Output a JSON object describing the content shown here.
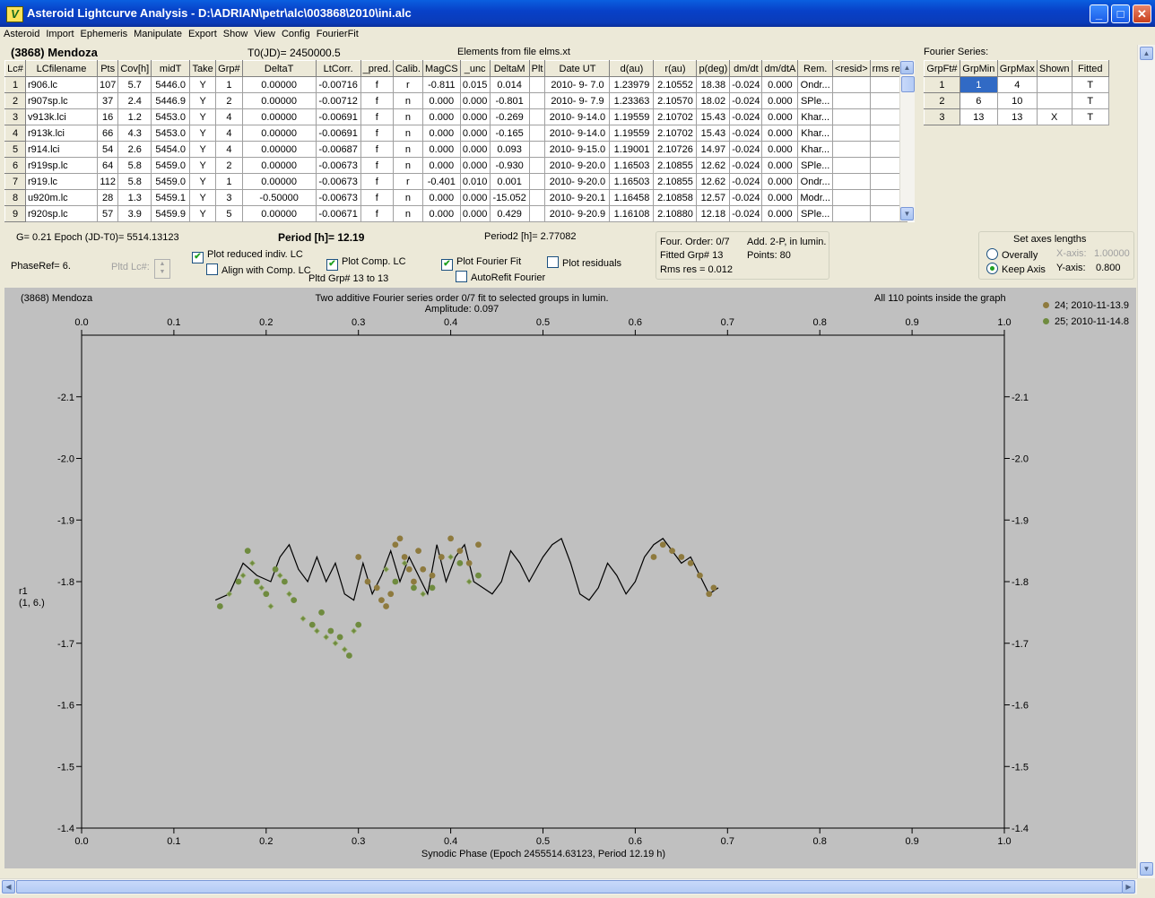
{
  "window": {
    "title": "Asteroid Lightcurve Analysis - D:\\ADRIAN\\petr\\alc\\003868\\2010\\ini.alc",
    "icon": "app-icon"
  },
  "menu": [
    "Asteroid",
    "Import",
    "Ephemeris",
    "Manipulate",
    "Export",
    "Show",
    "View",
    "Config",
    "FourierFit"
  ],
  "header": {
    "asteroid": "(3868) Mendoza",
    "t0": "T0(JD)= 2450000.5",
    "elements": "Elements from file elms.xt",
    "fourier_series_label": "Fourier Series:"
  },
  "table": {
    "columns": [
      "Lc#",
      "LCfilename",
      "Pts",
      "Cov[h]",
      "midT",
      "Take",
      "Grp#",
      "DeltaT",
      "LtCorr.",
      "_pred.",
      "Calib.",
      "MagCS",
      "_unc",
      "DeltaM",
      "Plt",
      "Date UT",
      "d(au)",
      "r(au)",
      "p(deg)",
      "dm/dt",
      "dm/dtA",
      "Rem.",
      "<resid>",
      "rms res"
    ],
    "rows": [
      [
        "1",
        "r906.lc",
        "107",
        "5.7",
        "5446.0",
        "Y",
        "1",
        "0.00000",
        "-0.00716",
        "f",
        "r",
        "-0.811",
        "0.015",
        "0.014",
        "",
        "2010- 9- 7.0",
        "1.23979",
        "2.10552",
        "18.38",
        "-0.024",
        "0.000",
        "Ondr...",
        "",
        ""
      ],
      [
        "2",
        "r907sp.lc",
        "37",
        "2.4",
        "5446.9",
        "Y",
        "2",
        "0.00000",
        "-0.00712",
        "f",
        "n",
        "0.000",
        "0.000",
        "-0.801",
        "",
        "2010- 9- 7.9",
        "1.23363",
        "2.10570",
        "18.02",
        "-0.024",
        "0.000",
        "SPle...",
        "",
        ""
      ],
      [
        "3",
        "v913k.lci",
        "16",
        "1.2",
        "5453.0",
        "Y",
        "4",
        "0.00000",
        "-0.00691",
        "f",
        "n",
        "0.000",
        "0.000",
        "-0.269",
        "",
        "2010- 9-14.0",
        "1.19559",
        "2.10702",
        "15.43",
        "-0.024",
        "0.000",
        "Khar...",
        "",
        ""
      ],
      [
        "4",
        "r913k.lci",
        "66",
        "4.3",
        "5453.0",
        "Y",
        "4",
        "0.00000",
        "-0.00691",
        "f",
        "n",
        "0.000",
        "0.000",
        "-0.165",
        "",
        "2010- 9-14.0",
        "1.19559",
        "2.10702",
        "15.43",
        "-0.024",
        "0.000",
        "Khar...",
        "",
        ""
      ],
      [
        "5",
        "r914.lci",
        "54",
        "2.6",
        "5454.0",
        "Y",
        "4",
        "0.00000",
        "-0.00687",
        "f",
        "n",
        "0.000",
        "0.000",
        "0.093",
        "",
        "2010- 9-15.0",
        "1.19001",
        "2.10726",
        "14.97",
        "-0.024",
        "0.000",
        "Khar...",
        "",
        ""
      ],
      [
        "6",
        "r919sp.lc",
        "64",
        "5.8",
        "5459.0",
        "Y",
        "2",
        "0.00000",
        "-0.00673",
        "f",
        "n",
        "0.000",
        "0.000",
        "-0.930",
        "",
        "2010- 9-20.0",
        "1.16503",
        "2.10855",
        "12.62",
        "-0.024",
        "0.000",
        "SPle...",
        "",
        ""
      ],
      [
        "7",
        "r919.lc",
        "112",
        "5.8",
        "5459.0",
        "Y",
        "1",
        "0.00000",
        "-0.00673",
        "f",
        "r",
        "-0.401",
        "0.010",
        "0.001",
        "",
        "2010- 9-20.0",
        "1.16503",
        "2.10855",
        "12.62",
        "-0.024",
        "0.000",
        "Ondr...",
        "",
        ""
      ],
      [
        "8",
        "u920m.lc",
        "28",
        "1.3",
        "5459.1",
        "Y",
        "3",
        "-0.50000",
        "-0.00673",
        "f",
        "n",
        "0.000",
        "0.000",
        "-15.052",
        "",
        "2010- 9-20.1",
        "1.16458",
        "2.10858",
        "12.57",
        "-0.024",
        "0.000",
        "Modr...",
        "",
        ""
      ],
      [
        "9",
        "r920sp.lc",
        "57",
        "3.9",
        "5459.9",
        "Y",
        "5",
        "0.00000",
        "-0.00671",
        "f",
        "n",
        "0.000",
        "0.000",
        "0.429",
        "",
        "2010- 9-20.9",
        "1.16108",
        "2.10880",
        "12.18",
        "-0.024",
        "0.000",
        "SPle...",
        "",
        ""
      ]
    ]
  },
  "fourier_table": {
    "columns": [
      "GrpFt#",
      "GrpMin",
      "GrpMax",
      "Shown",
      "Fitted"
    ],
    "rows": [
      [
        "1",
        "1",
        "4",
        "",
        "T"
      ],
      [
        "2",
        "6",
        "10",
        "",
        "T"
      ],
      [
        "3",
        "13",
        "13",
        "X",
        "T"
      ]
    ]
  },
  "info": {
    "g_epoch": "G= 0.21   Epoch (JD-T0)= 5514.13123",
    "period": "Period [h]= 12.19",
    "period2": "Period2 [h]= 2.77082",
    "phaseref": "PhaseRef= 6.",
    "pltd_lc": "Pltd Lc#:",
    "pltd_grp": "Pltd Grp#  13 to  13",
    "four_order": "Four. Order:  0/7",
    "add2p": "Add. 2-P, in lumin.",
    "fitted_grp": "Fitted Grp# 13",
    "points": "Points: 80",
    "rms": "Rms res    = 0.012"
  },
  "options": {
    "plot_reduced": "Plot reduced indiv. LC",
    "align_comp": "Align with Comp. LC",
    "plot_comp": "Plot Comp. LC",
    "plot_fourier": "Plot Fourier Fit",
    "plot_residuals": "Plot residuals",
    "autorefit": "AutoRefit Fourier"
  },
  "axes_box": {
    "title": "Set axes lengths",
    "overall": "Overally",
    "keep": "Keep Axis",
    "xaxis_label": "X-axis:",
    "xaxis_value": "1.00000",
    "yaxis_label": "Y-axis:",
    "yaxis_value": "0.800"
  },
  "chart_data": {
    "type": "scatter",
    "title": "Two additive Fourier series order 0/7 fit to selected groups in lumin.",
    "subtitle": "Amplitude: 0.097",
    "corner_left": "(3868) Mendoza",
    "corner_right": "All 110 points inside the graph",
    "xlabel": "Synodic Phase (Epoch 2455514.63123, Period 12.19 h)",
    "ylabel": "r1",
    "ylabel2": "(1, 6.)",
    "xlim": [
      0.0,
      1.0
    ],
    "ylim": [
      -2.2,
      -1.4
    ],
    "y_inverted": true,
    "xticks": [
      "0.0",
      "0.1",
      "0.2",
      "0.3",
      "0.4",
      "0.5",
      "0.6",
      "0.7",
      "0.8",
      "0.9",
      "1.0"
    ],
    "yticks": [
      "-2.1",
      "-2.0",
      "-1.9",
      "-1.8",
      "-1.7",
      "-1.6",
      "-1.5",
      "-1.4"
    ],
    "colors": {
      "series1": "#8e7a3e",
      "series2": "#6f8b3f",
      "fit": "#000000",
      "background": "#c0c0c0"
    },
    "series": [
      {
        "name": "24; 2010-11-13.9",
        "color": "#8e7a3e",
        "marker": "circle",
        "x": [
          0.3,
          0.31,
          0.32,
          0.325,
          0.33,
          0.335,
          0.34,
          0.345,
          0.35,
          0.355,
          0.36,
          0.365,
          0.37,
          0.38,
          0.39,
          0.4,
          0.41,
          0.42,
          0.43,
          0.62,
          0.63,
          0.64,
          0.65,
          0.66,
          0.67,
          0.68,
          0.685
        ],
        "y": [
          -1.84,
          -1.8,
          -1.79,
          -1.77,
          -1.76,
          -1.78,
          -1.86,
          -1.87,
          -1.84,
          -1.82,
          -1.8,
          -1.85,
          -1.82,
          -1.81,
          -1.84,
          -1.87,
          -1.85,
          -1.83,
          -1.86,
          -1.84,
          -1.86,
          -1.85,
          -1.84,
          -1.83,
          -1.81,
          -1.78,
          -1.79
        ]
      },
      {
        "name": "25; 2010-11-14.8",
        "color": "#6f8b3f",
        "marker": "mixed",
        "x": [
          0.15,
          0.16,
          0.17,
          0.175,
          0.18,
          0.185,
          0.19,
          0.195,
          0.2,
          0.205,
          0.21,
          0.215,
          0.22,
          0.225,
          0.23,
          0.24,
          0.25,
          0.255,
          0.26,
          0.265,
          0.27,
          0.275,
          0.28,
          0.285,
          0.29,
          0.295,
          0.3,
          0.33,
          0.34,
          0.35,
          0.36,
          0.37,
          0.38,
          0.4,
          0.41,
          0.42,
          0.43
        ],
        "y": [
          -1.76,
          -1.78,
          -1.8,
          -1.81,
          -1.85,
          -1.83,
          -1.8,
          -1.79,
          -1.78,
          -1.76,
          -1.82,
          -1.81,
          -1.8,
          -1.78,
          -1.77,
          -1.74,
          -1.73,
          -1.72,
          -1.75,
          -1.71,
          -1.72,
          -1.7,
          -1.71,
          -1.69,
          -1.68,
          -1.72,
          -1.73,
          -1.82,
          -1.8,
          -1.83,
          -1.79,
          -1.78,
          -1.79,
          -1.84,
          -1.83,
          -1.8,
          -1.81
        ]
      }
    ],
    "fit": {
      "x": [
        0.145,
        0.16,
        0.175,
        0.19,
        0.205,
        0.215,
        0.225,
        0.235,
        0.245,
        0.255,
        0.265,
        0.275,
        0.285,
        0.295,
        0.305,
        0.315,
        0.325,
        0.335,
        0.345,
        0.355,
        0.365,
        0.375,
        0.385,
        0.395,
        0.405,
        0.415,
        0.425,
        0.435,
        0.445,
        0.455,
        0.465,
        0.475,
        0.485,
        0.5,
        0.51,
        0.52,
        0.53,
        0.54,
        0.55,
        0.56,
        0.57,
        0.58,
        0.59,
        0.6,
        0.61,
        0.62,
        0.63,
        0.64,
        0.65,
        0.66,
        0.67,
        0.68,
        0.69
      ],
      "y": [
        -1.77,
        -1.78,
        -1.83,
        -1.81,
        -1.8,
        -1.84,
        -1.86,
        -1.82,
        -1.8,
        -1.84,
        -1.8,
        -1.83,
        -1.78,
        -1.77,
        -1.83,
        -1.78,
        -1.81,
        -1.85,
        -1.8,
        -1.84,
        -1.81,
        -1.78,
        -1.86,
        -1.8,
        -1.84,
        -1.86,
        -1.8,
        -1.79,
        -1.78,
        -1.8,
        -1.85,
        -1.83,
        -1.8,
        -1.84,
        -1.86,
        -1.87,
        -1.83,
        -1.78,
        -1.77,
        -1.79,
        -1.83,
        -1.81,
        -1.78,
        -1.8,
        -1.84,
        -1.86,
        -1.87,
        -1.85,
        -1.83,
        -1.84,
        -1.81,
        -1.78,
        -1.79
      ]
    }
  }
}
